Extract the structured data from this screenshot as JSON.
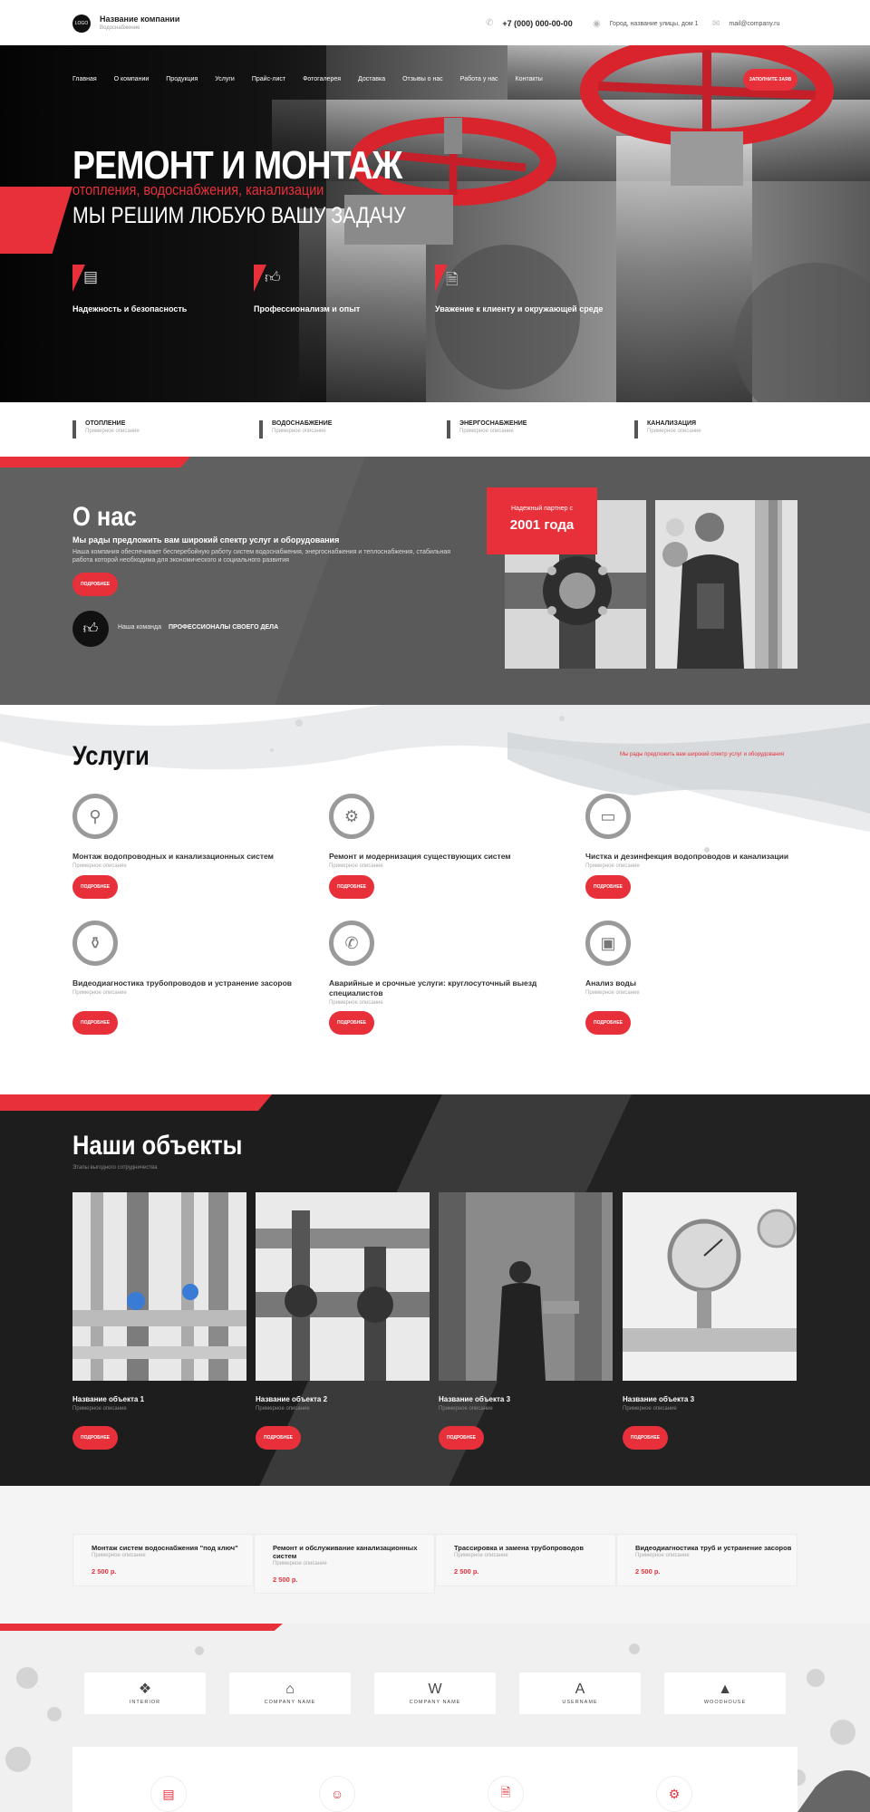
{
  "header": {
    "logo_text": "LOGO",
    "company_name": "Название компании",
    "company_sub": "Водоснабжение",
    "phone": "+7 (000) 000-00-00",
    "address": "Город, название улицы, дом 1",
    "email": "mail@company.ru"
  },
  "nav": [
    "Главная",
    "О компании",
    "Продукция",
    "Услуги",
    "Прайс-лист",
    "Фотогалерея",
    "Доставка",
    "Отзывы о нас",
    "Работа у нас",
    "Контакты"
  ],
  "hero": {
    "cta": "ЗАПОЛНИТЕ ЗАЯВ",
    "title": "РЕМОНТ И МОНТАЖ",
    "subtitle1": "отопления, водоснабжения, канализации",
    "subtitle2": "МЫ РЕШИМ ЛЮБУЮ ВАШУ ЗАДАЧУ",
    "features": [
      {
        "label": "Надежность и безопасность",
        "icon": "certificate-icon"
      },
      {
        "label": "Профессионализм и опыт",
        "icon": "thumbs-up-icon"
      },
      {
        "label": "Уважение к клиенту и окружающей среде",
        "icon": "document-icon"
      }
    ]
  },
  "categories": [
    {
      "title": "ОТОПЛЕНИЕ",
      "sub": "Примерное описание"
    },
    {
      "title": "ВОДОСНАБЖЕНИЕ",
      "sub": "Примерное описание"
    },
    {
      "title": "ЭНЕРГОСНАБЖЕНИЕ",
      "sub": "Примерное описание"
    },
    {
      "title": "КАНАЛИЗАЦИЯ",
      "sub": "Примерное описание"
    }
  ],
  "about": {
    "title": "О нас",
    "lead": "Мы рады предложить вам широкий спектр услуг и оборудования",
    "body": "Наша компания обеспечивает бесперебойную работу систем водоснабжения, энергоснабжения и теплоснабжения, стабильная работа которой необходима для экономического и социального развития",
    "button": "ПОДРОБНЕЕ",
    "team_label": "Наша команда",
    "team_value": "ПРОФЕССИОНАЛЫ СВОЕГО ДЕЛА",
    "partner_label": "Надежный партнер с",
    "partner_year": "2001 года"
  },
  "services": {
    "title": "Услуги",
    "tagline": "Мы рады предложить вам широкий спектр услуг и оборудования",
    "button": "ПОДРОБНЕЕ",
    "items": [
      {
        "name": "Монтаж водопроводных и канализационных систем",
        "desc": "Примерное описание",
        "icon": "valve-icon"
      },
      {
        "name": "Ремонт и модернизация существующих систем",
        "desc": "Примерное описание",
        "icon": "gear-icon"
      },
      {
        "name": "Чистка и дезинфекция водопроводов и канализации",
        "desc": "Примерное описание",
        "icon": "pipe-icon"
      },
      {
        "name": "Видеодиагностика трубопроводов и устранение засоров",
        "desc": "Примерное описание",
        "icon": "pipe-valve-icon"
      },
      {
        "name": "Аварийные и срочные услуги: круглосуточный выезд специалистов",
        "desc": "Примерное описание",
        "icon": "phone-icon"
      },
      {
        "name": "Анализ воды",
        "desc": "Примерное описание",
        "icon": "clipboard-icon"
      }
    ]
  },
  "objects": {
    "title": "Наши объекты",
    "subtitle": "Этапы выгодного сотрудничества",
    "button": "ПОДРОБНЕЕ",
    "items": [
      {
        "title": "Название объекта 1",
        "desc": "Примерное описание"
      },
      {
        "title": "Название объекта 2",
        "desc": "Примерное описание"
      },
      {
        "title": "Название объекта 3",
        "desc": "Примерное описание"
      },
      {
        "title": "Название объекта 3",
        "desc": "Примерное описание"
      }
    ]
  },
  "prices": [
    {
      "title": "Монтаж систем водоснабжения \"под ключ\"",
      "desc": "Примерное описание",
      "value": "2 500 р."
    },
    {
      "title": "Ремонт и обслуживание канализационных систем",
      "desc": "Примерное описание",
      "value": "2 500 р."
    },
    {
      "title": "Трассировка и замена трубопроводов",
      "desc": "Примерное описание",
      "value": "2 500 р."
    },
    {
      "title": "Видеодиагностика труб и устранение засоров",
      "desc": "Примерное описание",
      "value": "2 500 р."
    }
  ],
  "partners": [
    {
      "name": "INTERIOR",
      "icon": "interior-logo-icon"
    },
    {
      "name": "COMPANY NAME",
      "icon": "house-logo-icon"
    },
    {
      "name": "COMPANY NAME",
      "icon": "wing-logo-icon"
    },
    {
      "name": "USERNAME",
      "icon": "letter-a-logo-icon"
    },
    {
      "name": "WOODHOUSE",
      "icon": "house-stack-logo-icon"
    }
  ],
  "colors": {
    "accent": "#e8303a",
    "dark": "#121212",
    "gray_section": "#5a5a5a"
  }
}
